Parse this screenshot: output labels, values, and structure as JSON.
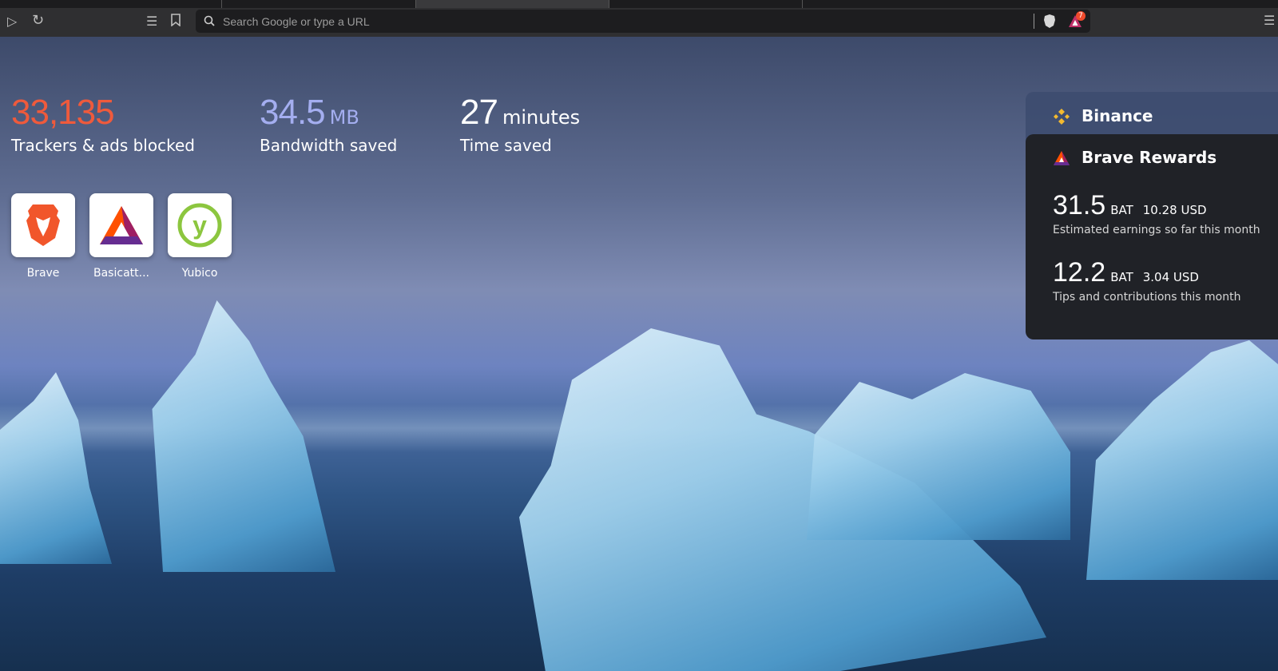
{
  "toolbar": {
    "search_placeholder": "Search Google or type a URL",
    "rewards_badge": "7"
  },
  "stats": [
    {
      "value": "33,135",
      "unit": "",
      "label": "Trackers & ads blocked",
      "color": "#ef5a3c"
    },
    {
      "value": "34.5",
      "unit": "MB",
      "label": "Bandwidth saved",
      "color": "#a4aef0"
    },
    {
      "value": "27",
      "unit": "minutes",
      "label": "Time saved",
      "color": "#ffffff"
    }
  ],
  "top_sites": [
    {
      "label": "Brave"
    },
    {
      "label": "Basicatt..."
    },
    {
      "label": "Yubico"
    }
  ],
  "binance": {
    "title": "Binance"
  },
  "rewards": {
    "title": "Brave Rewards",
    "earnings": {
      "value": "31.5",
      "unit": "BAT",
      "usd": "10.28 USD",
      "desc": "Estimated earnings so far this month"
    },
    "tips": {
      "value": "12.2",
      "unit": "BAT",
      "usd": "3.04 USD",
      "desc": "Tips and contributions this month"
    }
  }
}
